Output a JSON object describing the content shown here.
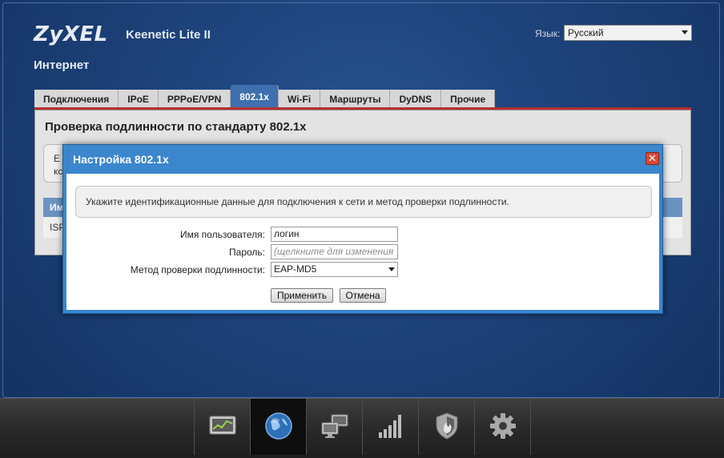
{
  "header": {
    "logo": "ZyXEL",
    "model": "Keenetic Lite II",
    "language_label": "Язык:",
    "language_value": "Русский"
  },
  "section_title": "Интернет",
  "tabs": [
    {
      "label": "Подключения",
      "active": false
    },
    {
      "label": "IPoE",
      "active": false
    },
    {
      "label": "PPPoE/VPN",
      "active": false
    },
    {
      "label": "802.1x",
      "active": true
    },
    {
      "label": "Wi-Fi",
      "active": false
    },
    {
      "label": "Маршруты",
      "active": false
    },
    {
      "label": "DyDNS",
      "active": false
    },
    {
      "label": "Прочие",
      "active": false
    }
  ],
  "panel": {
    "title": "Проверка подлинности по стандарту 802.1x",
    "box_line1": "Е",
    "box_line2": "кс",
    "table_header": "Им",
    "table_row": "ISP"
  },
  "dialog": {
    "title": "Настройка 802.1x",
    "close_glyph": "✕",
    "hint": "Укажите идентификационные данные для подключения к сети и метод проверки подлинности.",
    "username_label": "Имя пользователя:",
    "username_value": "логин",
    "password_label": "Пароль:",
    "password_placeholder": "(щелкните для изменения",
    "method_label": "Метод проверки подлинности:",
    "method_value": "EAP-MD5",
    "apply_label": "Применить",
    "cancel_label": "Отмена"
  },
  "bottom_nav": [
    {
      "icon": "monitor-chart-icon",
      "active": false
    },
    {
      "icon": "globe-icon",
      "active": true
    },
    {
      "icon": "computers-network-icon",
      "active": false
    },
    {
      "icon": "signal-bars-icon",
      "active": false
    },
    {
      "icon": "shield-icon",
      "active": false
    },
    {
      "icon": "gear-icon",
      "active": false
    }
  ],
  "colors": {
    "accent_blue": "#3b86cc",
    "tab_active": "#3f6fae",
    "tab_underline": "#b52f2f",
    "close_red": "#d84a3a"
  }
}
